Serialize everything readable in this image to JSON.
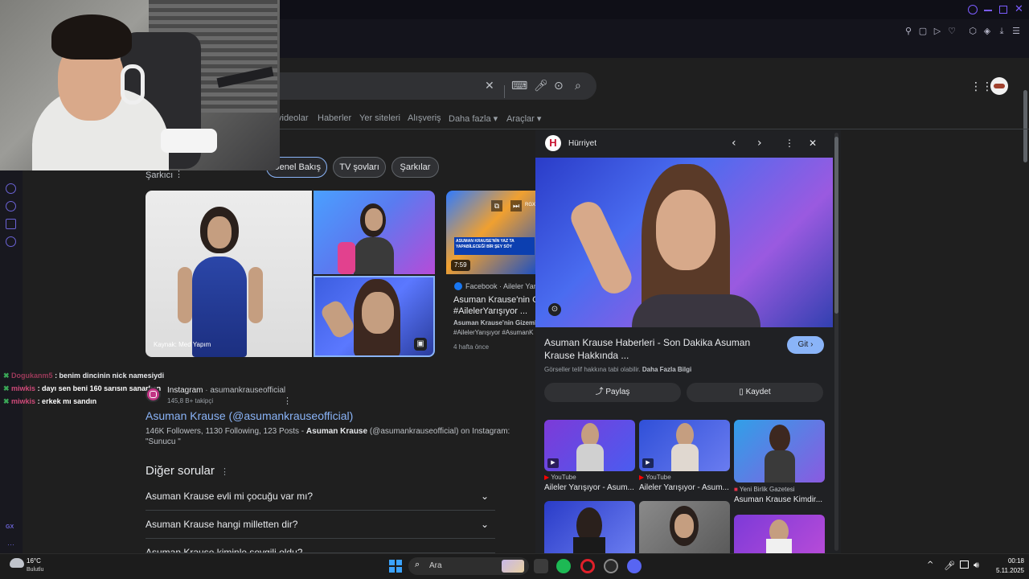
{
  "search": {
    "tabs": [
      "videolar",
      "Haberler",
      "Yer siteleri",
      "Alışveriş",
      "Daha fazla ▾",
      "Araçlar ▾"
    ],
    "chips": [
      "Genel Bakış",
      "TV şovları",
      "Şarkılar"
    ]
  },
  "knowledge": {
    "subtitle": "Şarkıcı",
    "image_credit": "Kaynak: Med Yapım"
  },
  "video_card": {
    "duration": "7:59",
    "source": "Facebook · Aileler Yarışı",
    "title_line1": "Asuman Krause'nin Gize",
    "title_line2": "#AilelerYarışıyor ...",
    "desc_line1": "Asuman Krause'nin Gizemli",
    "desc_line2": "#AilelerYarışıyor #AsumanK",
    "date": "4 hafta önce",
    "overlay_text": "ASUMAN KRAUSE'NİN YAZ TA YAPABİLECEĞİ BİR ŞEY SÖY",
    "rgx": "RGX"
  },
  "instagram": {
    "source": "Instagram",
    "handle": "asumankrauseofficial",
    "followers": "145,8 B+ takipçi",
    "link_title": "Asuman Krause (@asumankrauseofficial)",
    "snippet_pre": "146K Followers, 1130 Following, 123 Posts - ",
    "snippet_bold": "Asuman Krause",
    "snippet_post": " (@asumankrauseofficial) on Instagram:",
    "snippet_line2": "\"Sunucu \""
  },
  "faq": {
    "title": "Diğer sorular",
    "questions": [
      "Asuman Krause evli mi çocuğu var mı?",
      "Asuman Krause hangi milletten dir?",
      "Asuman Krause kiminle sevgili oldu?"
    ]
  },
  "panel": {
    "site": "Hürriyet",
    "logo": "H",
    "headline_line1": "Asuman Krause Haberleri - Son Dakika Asuman",
    "headline_line2": "Krause Hakkında ...",
    "go_button": "Git ›",
    "rights": "Görseller telif hakkına tabi olabilir.",
    "more_info": "Daha Fazla Bilgi",
    "share": "Paylaş",
    "save": "Kaydet",
    "related": [
      {
        "source": "YouTube",
        "title": "Aileler Yarışıyor - Asum..."
      },
      {
        "source": "YouTube",
        "title": "Aileler Yarışıyor - Asum..."
      },
      {
        "source": "Yeni Birlik Gazetesi",
        "title": "Asuman Krause Kimdir..."
      }
    ]
  },
  "chat": [
    {
      "user": "Dogukanm5",
      "msg": " : benim dincinin nick namesiydi",
      "color": "#9c3a5a"
    },
    {
      "user": "miwkis",
      "msg": " : dayı sen beni 160 sarısın sanarken",
      "color": "#d04a7a"
    },
    {
      "user": "miwkis",
      "msg": " : erkek mı sandın",
      "color": "#d04a7a"
    }
  ],
  "sidebar_small": "GX",
  "taskbar": {
    "weather_temp": "16°C",
    "weather_desc": "Bulutlu",
    "search_placeholder": "Ara",
    "time": "00:18",
    "date": "5.11.2025"
  },
  "colors": {
    "accent": "#8ab4f8",
    "gx_purple": "#6b63d6",
    "instagram_pink": "#c13584"
  }
}
